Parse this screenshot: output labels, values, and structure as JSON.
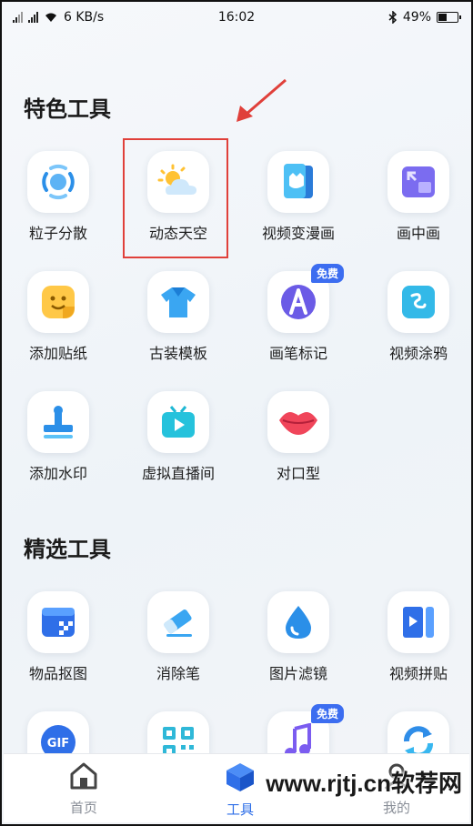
{
  "status": {
    "speed": "6 KB/s",
    "time": "16:02",
    "battery": "49%",
    "battery_level": 0.49
  },
  "sections": {
    "featured_title": "特色工具",
    "selected_title": "精选工具"
  },
  "featured_tools": [
    {
      "label": "粒子分散",
      "icon": "particle-icon"
    },
    {
      "label": "动态天空",
      "icon": "sky-icon"
    },
    {
      "label": "视频变漫画",
      "icon": "comic-icon"
    },
    {
      "label": "画中画",
      "icon": "pip-icon"
    },
    {
      "label": "添加贴纸",
      "icon": "sticker-icon"
    },
    {
      "label": "古装模板",
      "icon": "costume-icon"
    },
    {
      "label": "画笔标记",
      "icon": "brush-icon",
      "badge": "免费"
    },
    {
      "label": "视频涂鸦",
      "icon": "doodle-icon"
    },
    {
      "label": "添加水印",
      "icon": "watermark-icon"
    },
    {
      "label": "虚拟直播间",
      "icon": "live-icon"
    },
    {
      "label": "对口型",
      "icon": "lips-icon"
    }
  ],
  "selected_tools": [
    {
      "label": "物品抠图",
      "icon": "cutout-icon"
    },
    {
      "label": "消除笔",
      "icon": "eraser-icon"
    },
    {
      "label": "图片滤镜",
      "icon": "filter-icon"
    },
    {
      "label": "视频拼贴",
      "icon": "collage-icon"
    },
    {
      "label": "",
      "icon": "gif-icon"
    },
    {
      "label": "",
      "icon": "qrcode-icon"
    },
    {
      "label": "",
      "icon": "music-icon",
      "badge": "免费"
    },
    {
      "label": "",
      "icon": "refresh-icon"
    }
  ],
  "tabs": [
    {
      "label": "首页",
      "icon": "home-icon",
      "active": false
    },
    {
      "label": "工具",
      "icon": "tools-cube-icon",
      "active": true
    },
    {
      "label": "我的",
      "icon": "profile-icon",
      "active": false
    }
  ],
  "watermark": "www.rjtj.cn软荐网",
  "colors": {
    "accent": "#2f6fe8",
    "badge": "#3c6df0",
    "highlight": "#e0403a",
    "tab_inactive": "#8a8f98"
  }
}
